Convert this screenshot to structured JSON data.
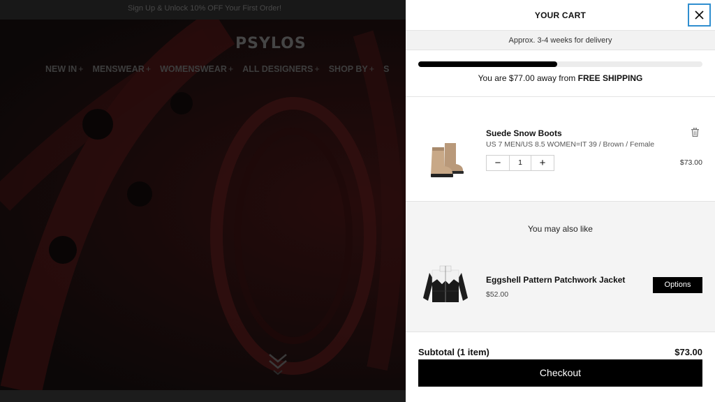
{
  "background": {
    "announcement": "Sign Up & Unlock 10% OFF Your First Order!",
    "logo": "PSYLOS",
    "nav": [
      {
        "label": "NEW IN"
      },
      {
        "label": "MENSWEAR"
      },
      {
        "label": "WOMENSWEAR"
      },
      {
        "label": "ALL DESIGNERS"
      },
      {
        "label": "SHOP BY"
      },
      {
        "label": "S"
      }
    ],
    "nav_plus": "+"
  },
  "cart": {
    "title": "YOUR CART",
    "close_icon": "close-icon",
    "delivery_note": "Approx. 3-4 weeks for delivery",
    "shipping": {
      "progress": 0.49,
      "prefix": "You are $77.00 away from",
      "emphasis": "FREE SHIPPING"
    },
    "items": [
      {
        "name": "Suede Snow Boots",
        "variant": "US 7 MEN/US 8.5 WOMEN=IT 39 / Brown / Female",
        "quantity": "1",
        "price": "$73.00",
        "minus": "−",
        "plus": "+",
        "remove_icon": "trash-icon"
      }
    ],
    "upsell": {
      "title": "You may also like",
      "product": {
        "name": "Eggshell Pattern Patchwork Jacket",
        "price": "$52.00",
        "button": "Options"
      }
    },
    "subtotal_label": "Subtotal (1 item)",
    "subtotal_value": "$73.00",
    "checkout": "Checkout"
  },
  "colors": {
    "accent_focus": "#2f8ecf",
    "button_black": "#000000",
    "hero_red": "#7a1414"
  }
}
